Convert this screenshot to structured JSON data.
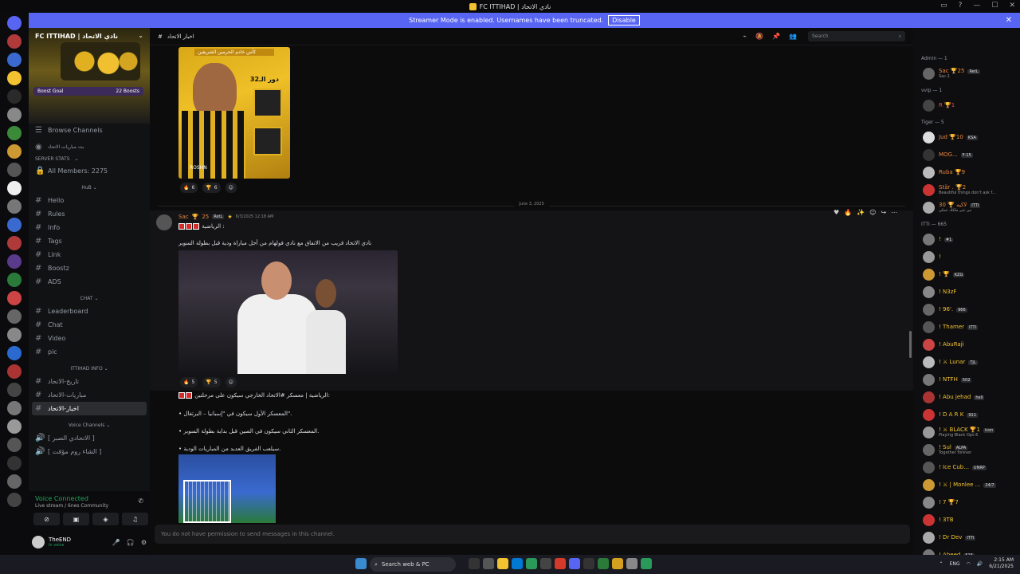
{
  "window": {
    "title": "FC ITTIHAD | نادي الاتحاد"
  },
  "banner": {
    "text": "Streamer Mode is enabled. Usernames have been truncated.",
    "button": "Disable"
  },
  "server": {
    "name": "FC ITTIHAD | نادي الاتحاد",
    "boost_goal": "Boost Goal",
    "boosts": "22 Boosts",
    "browse": "Browse Channels"
  },
  "channels": {
    "top": "بث مباريات الاتحاد",
    "cat_stats": "SERVER STATS",
    "all_members": "All Members: 2275",
    "cat_hub": "HuB",
    "hub": [
      "Hello",
      "Rules",
      "Info",
      "Tags",
      "Link",
      "Boostz",
      "ADS"
    ],
    "cat_chat": "CHAT",
    "chat": [
      "Leaderboard",
      "Chat",
      "Video",
      "pic"
    ],
    "cat_info": "ITTIHAD INFO",
    "info": [
      "تاريخ-الاتحاد",
      "مباريات-الاتحاد",
      "اخبار-الاتحاد"
    ],
    "cat_voice": "Voice Channels",
    "voice": [
      "[ الاتحادي الصبر ]",
      "[ الشاء روم مؤقت ]"
    ]
  },
  "voice": {
    "connected": "Voice Connected",
    "detail": "Live stream / 6nes Community"
  },
  "user": {
    "name": "TheEND",
    "status": "In voice"
  },
  "main": {
    "channel": "اخبار الاتحاد",
    "search_placeholder": "Search",
    "poster_top": "كأس خادم الحرمين الشريفين",
    "poster_round": "دور الـ32",
    "poster_sponsor": "ROSHN",
    "reactions1": [
      {
        "emoji": "🔥",
        "count": "6"
      },
      {
        "emoji": "🏆",
        "count": "6"
      }
    ],
    "date_divider": "June 3, 2025",
    "author": "Sac",
    "author_badge": "25",
    "author_tag": "RetL",
    "timestamp": "6/3/2025 12:18 AM",
    "line1": "الرياضية :",
    "line2": "نادي الاتحاد قريب من الاتفاق مع نادي فولهام من أجل مباراة ودية قبل بطولة السوبر",
    "reactions2": [
      {
        "emoji": "🔥",
        "count": "5"
      },
      {
        "emoji": "🏆",
        "count": "5"
      }
    ],
    "line3": "الرياضية | معسكر #الاتحاد الخارجي سيكون على مرحلتين:",
    "line4": "• المعسكر الأول سيكون في \"إسبانيا – البرتغال\".",
    "line5": "• المعسكر الثاني سيكون في الصين قبل بداية بطولة السوبر.",
    "line6": "• سيلعب الفريق العديد من المباريات الودية.",
    "input_placeholder": "You do not have permission to send messages in this channel."
  },
  "members": {
    "groups": [
      {
        "label": "Admin — 1",
        "items": [
          {
            "name": "Sac 🏆25",
            "sub": "Sac-1",
            "color": "#e7863f",
            "av": "#666",
            "tag": "RetL"
          }
        ]
      },
      {
        "label": "vvip — 1",
        "items": [
          {
            "name": "R 🏆1",
            "sub": "",
            "color": "#f04b4b",
            "av": "#444",
            "tag": ""
          }
        ]
      },
      {
        "label": "Tiger — 5",
        "items": [
          {
            "name": "Jud 🏆10",
            "sub": "",
            "color": "#e7863f",
            "av": "#ddd",
            "tag": "KSA"
          },
          {
            "name": "MOG...",
            "sub": "",
            "color": "#e7863f",
            "av": "#333",
            "tag": "F-15"
          },
          {
            "name": "Ruba 🏆9",
            "sub": "",
            "color": "#e7863f",
            "av": "#bbb",
            "tag": ""
          },
          {
            "name": "Stär . 🏆2",
            "sub": "Beautiful things don't ask f...",
            "color": "#e7863f",
            "av": "#c33",
            "tag": ""
          },
          {
            "name": "30 🏆 لاكيه",
            "sub": "من غير ملكك عملي",
            "color": "#e7863f",
            "av": "#aaa",
            "tag": "ITTI"
          }
        ]
      },
      {
        "label": "ITTI — 665",
        "items": [
          {
            "name": "!",
            "sub": "",
            "color": "#f2c230",
            "av": "#777",
            "tag": "#1"
          },
          {
            "name": "!",
            "sub": "",
            "color": "#f2c230",
            "av": "#999",
            "tag": ""
          },
          {
            "name": "! 🏆",
            "sub": "",
            "color": "#f2c230",
            "av": "#c93",
            "tag": "KZG"
          },
          {
            "name": "! N3zF",
            "sub": "",
            "color": "#f2c230",
            "av": "#888",
            "tag": ""
          },
          {
            "name": "! 96'.",
            "sub": "",
            "color": "#f2c230",
            "av": "#666",
            "tag": "966"
          },
          {
            "name": "! Thamer",
            "sub": "",
            "color": "#f2c230",
            "av": "#555",
            "tag": "ITTI"
          },
          {
            "name": "! AbuRaji",
            "sub": "",
            "color": "#f2c230",
            "av": "#c44",
            "tag": ""
          },
          {
            "name": "! ⚔ Lunar",
            "sub": "",
            "color": "#f2c230",
            "av": "#bbb",
            "tag": "TJL"
          },
          {
            "name": "! NTFH",
            "sub": "",
            "color": "#f2c230",
            "av": "#777",
            "tag": "502"
          },
          {
            "name": "! Abu jehad",
            "sub": "",
            "color": "#f2c230",
            "av": "#a33",
            "tag": "hell"
          },
          {
            "name": "! D A R K",
            "sub": "",
            "color": "#f2c230",
            "av": "#c33",
            "tag": "911"
          },
          {
            "name": "! ⚔ BLACK 🏆1",
            "sub": "Playing Black Ops 6",
            "color": "#f2c230",
            "av": "#999",
            "tag": "icon"
          },
          {
            "name": "! Sul",
            "sub": "Together forever",
            "color": "#f2c230",
            "av": "#666",
            "tag": "ALPA"
          },
          {
            "name": "! Ice Cub...",
            "sub": "",
            "color": "#f2c230",
            "av": "#555",
            "tag": "UNRP"
          },
          {
            "name": "! ⚔ | Monlee ...",
            "sub": "",
            "color": "#f2c230",
            "av": "#c93",
            "tag": "24/7"
          },
          {
            "name": "! 7 🏆7",
            "sub": "",
            "color": "#f2c230",
            "av": "#888",
            "tag": ""
          },
          {
            "name": "! 3TB",
            "sub": "",
            "color": "#f2c230",
            "av": "#c33",
            "tag": ""
          },
          {
            "name": "! Dr Dev",
            "sub": "",
            "color": "#f2c230",
            "av": "#aaa",
            "tag": "ITTI"
          },
          {
            "name": "! Abeed",
            "sub": "",
            "color": "#f2c230",
            "av": "#777",
            "tag": "515"
          }
        ]
      }
    ]
  },
  "taskbar": {
    "search": "Search web & PC",
    "lang": "ENG",
    "time": "2:15 AM",
    "date": "6/21/2025"
  }
}
